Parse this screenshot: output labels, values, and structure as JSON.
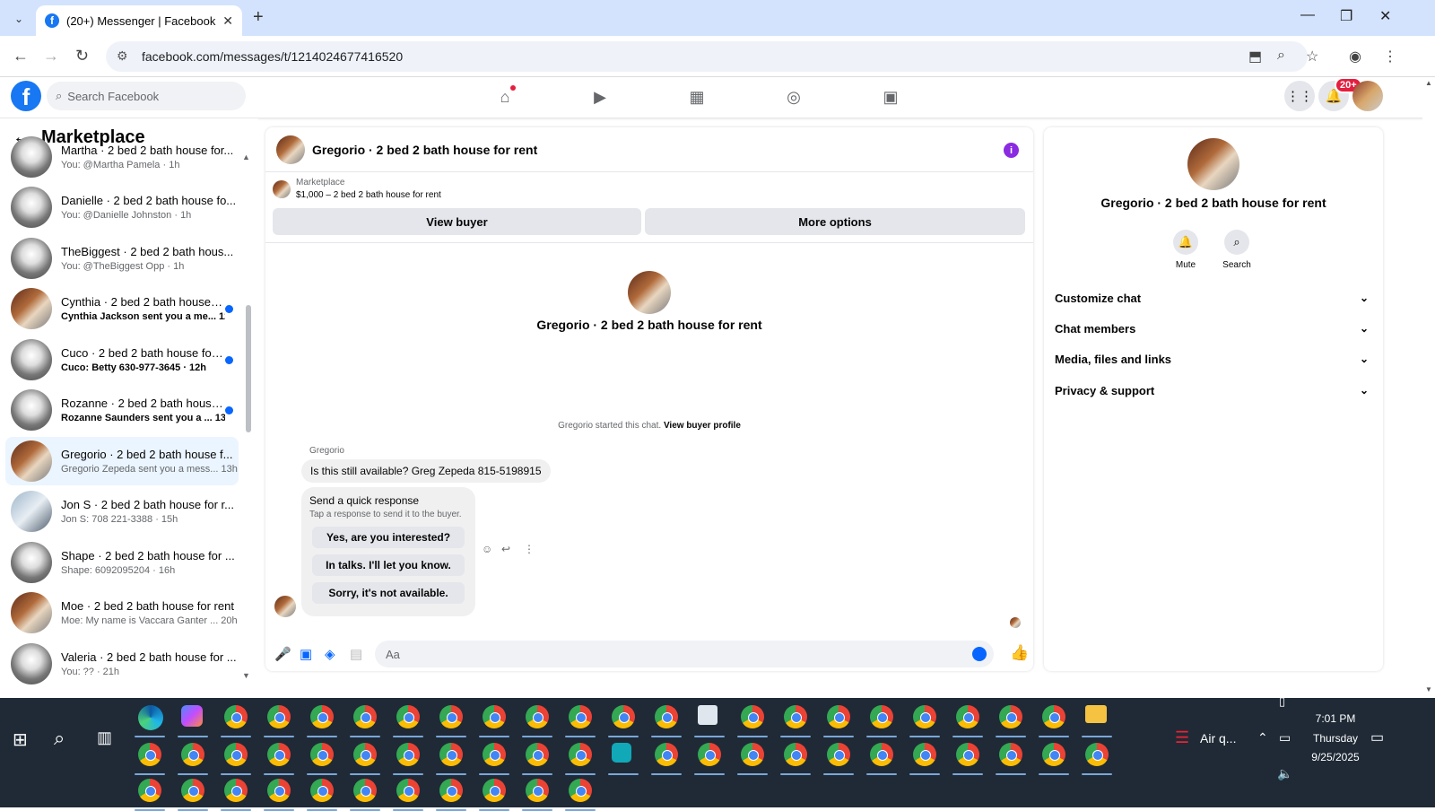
{
  "browser": {
    "tab_title": "(20+) Messenger | Facebook",
    "url": "facebook.com/messages/t/1214024677416520"
  },
  "fb": {
    "search_placeholder": "Search Facebook",
    "notif_badge": "20+"
  },
  "sidebar": {
    "title": "Marketplace",
    "conversations": [
      {
        "name": "Martha · 2 bed 2 bath house for...",
        "preview": "You: @Martha Pamela · 1h",
        "unread": false
      },
      {
        "name": "Danielle · 2 bed 2 bath house fo...",
        "preview": "You: @Danielle Johnston · 1h",
        "unread": false
      },
      {
        "name": "TheBiggest · 2 bed 2 bath hous...",
        "preview": "You: @TheBiggest Opp · 1h",
        "unread": false
      },
      {
        "name": "Cynthia · 2 bed 2 bath house f...",
        "preview": "Cynthia Jackson sent you a me... 12h",
        "unread": true
      },
      {
        "name": "Cuco · 2 bed 2 bath house for ...",
        "preview": "Cuco: Betty 630-977-3645 · 12h",
        "unread": true
      },
      {
        "name": "Rozanne · 2 bed 2 bath house ...",
        "preview": "Rozanne Saunders sent you a ... 13h",
        "unread": true
      },
      {
        "name": "Gregorio · 2 bed 2 bath house f...",
        "preview": "Gregorio Zepeda sent you a mess... 13h",
        "unread": false,
        "selected": true
      },
      {
        "name": "Jon S · 2 bed 2 bath house for r...",
        "preview": "Jon S: 708 221-3388 · 15h",
        "unread": false
      },
      {
        "name": "Shape · 2 bed 2 bath house for ...",
        "preview": "Shape: 6092095204 · 16h",
        "unread": false
      },
      {
        "name": "Moe · 2 bed 2 bath house for rent",
        "preview": "Moe: My name is Vaccara Ganter ... 20h",
        "unread": false
      },
      {
        "name": "Valeria · 2 bed 2 bath house for ...",
        "preview": "You: ?? · 21h",
        "unread": false
      }
    ]
  },
  "chat": {
    "title": "Gregorio · 2 bed 2 bath house for rent",
    "marketplace_label": "Marketplace",
    "listing": "$1,000 – 2 bed 2 bath house for rent",
    "view_buyer": "View buyer",
    "more_options": "More options",
    "hero_title": "Gregorio · 2 bed 2 bath house for rent",
    "started_text": "Gregorio started this chat.",
    "view_profile": "View buyer profile",
    "sender": "Gregorio",
    "message": "Is this still available? Greg Zepeda 815-5198915",
    "quick_title": "Send a quick response",
    "quick_sub": "Tap a response to send it to the buyer.",
    "quick_options": [
      "Yes, are you interested?",
      "In talks. I'll let you know.",
      "Sorry, it's not available."
    ],
    "composer_placeholder": "Aa"
  },
  "details": {
    "title": "Gregorio · 2 bed 2 bath house for rent",
    "mute": "Mute",
    "search": "Search",
    "rows": [
      "Customize chat",
      "Chat members",
      "Media, files and links",
      "Privacy & support"
    ]
  },
  "taskbar": {
    "weather": "Air q...",
    "time": "7:01 PM",
    "day": "Thursday",
    "date": "9/25/2025"
  },
  "colors": {
    "accent": "#0866ff",
    "brand": "#1877f2",
    "badge": "#e41e3f",
    "info": "#8a2be2"
  }
}
